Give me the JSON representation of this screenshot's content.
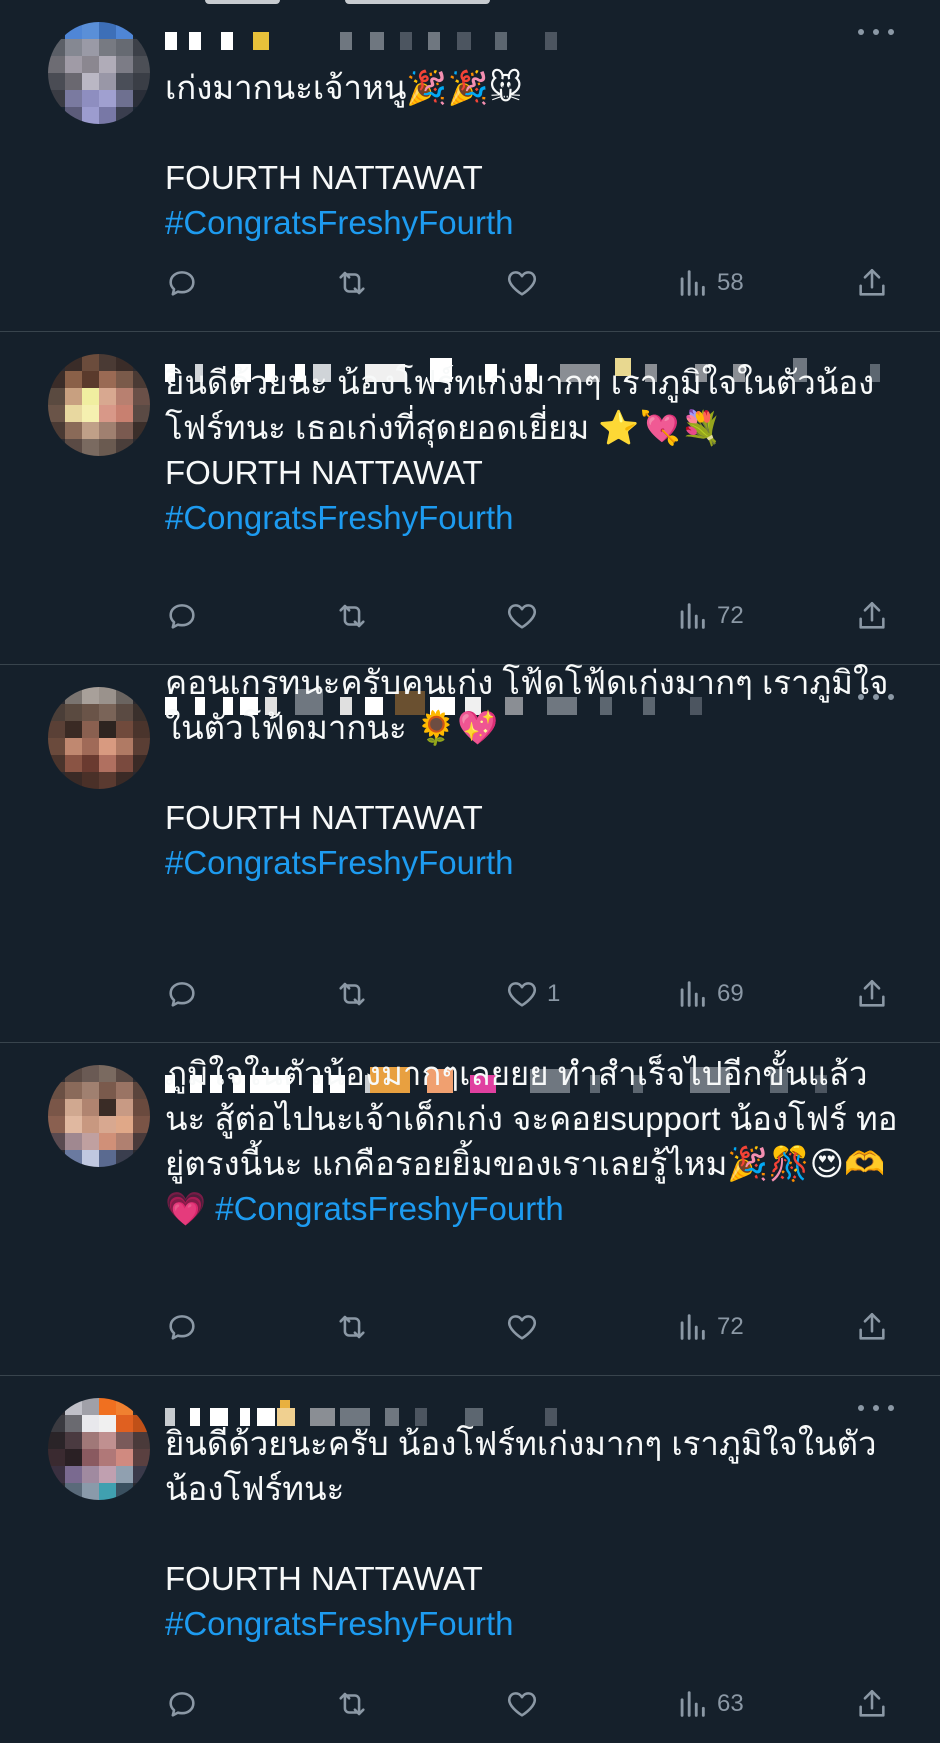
{
  "tweets": [
    {
      "text": "เก่งมากนะเจ้าหนู🎉🎉🐭\n\nFOURTH NATTAWAT",
      "hashtag": "#CongratsFreshyFourth",
      "likes": "",
      "views": "58"
    },
    {
      "text": "ยินดีด้วยนะ น้องโฟร์ทเก่งมากๆ เราภูมิใจในตัวน้อง โฟร์ทนะ เธอเก่งที่สุดยอดเยี่ยม ⭐💘💐\nFOURTH NATTAWAT",
      "hashtag": "#CongratsFreshyFourth",
      "likes": "",
      "views": "72"
    },
    {
      "text": "คอนเกรทนะครับคนเก่ง โฟ้ดโฟ้ดเก่งมากๆ เราภูมิใจ ในตัวโฟ้ดมากนะ 🌻💖\n\nFOURTH NATTAWAT",
      "hashtag": "#CongratsFreshyFourth",
      "likes": "1",
      "views": "69"
    },
    {
      "text": "ภูมิใจในตัวน้องมากๆเลยยย ทำสำเร็จไปอีกขั้นแล้ว นะ สู้ต่อไปนะเจ้าเด็กเก่ง จะคอยsupport น้องโฟร์ ทอยู่ตรงนี้นะ แกคือรอยยิ้มของเราเลยรู้ไหม🎉🎊😍🫶💗",
      "hashtag": "#CongratsFreshyFourth",
      "likes": "",
      "views": "72"
    },
    {
      "text": "ยินดีด้วยนะครับ น้องโฟร์ทเก่งมากๆ เราภูมิใจในตัว น้องโฟร์ทนะ\n\nFOURTH NATTAWAT",
      "hashtag": "#CongratsFreshyFourth",
      "likes": "",
      "views": "63"
    }
  ],
  "icons": {
    "reply": "reply-icon",
    "retweet": "retweet-icon",
    "like": "heart-icon",
    "views": "views-icon",
    "share": "share-icon",
    "more": "more-icon"
  },
  "colors": {
    "background": "#15202b",
    "text": "#f7f9f9",
    "hashtag": "#1d9bf0",
    "muted": "#8b98a5",
    "divider": "#38444d"
  }
}
